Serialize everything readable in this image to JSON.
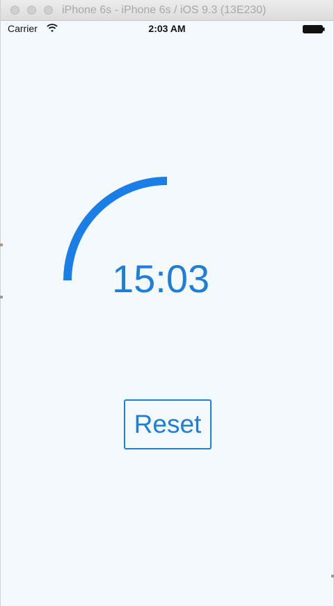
{
  "window": {
    "title": "iPhone 6s - iPhone 6s / iOS 9.3 (13E230)"
  },
  "status_bar": {
    "carrier": "Carrier",
    "time": "2:03 AM",
    "wifi_icon": "wifi-icon",
    "battery_icon": "battery-icon"
  },
  "timer": {
    "display": "15:03",
    "progress_fraction": 0.25,
    "accent_color": "#1e7ed8",
    "arc_color": "#1a7ee6"
  },
  "actions": {
    "reset_label": "Reset"
  },
  "colors": {
    "background": "#f3f9fd",
    "text": "#111111"
  }
}
